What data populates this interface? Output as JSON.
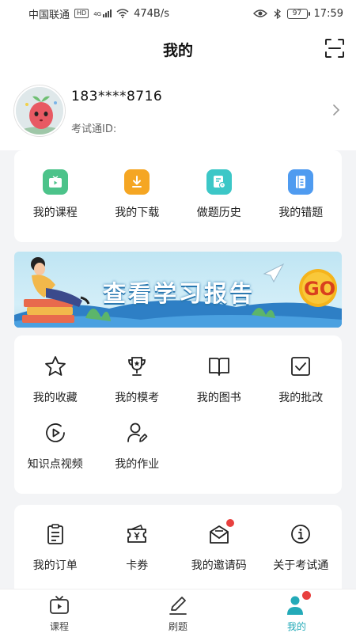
{
  "status_bar": {
    "carrier": "中国联通",
    "hd": "HD",
    "net": "4G",
    "speed": "474B/s",
    "battery": "97",
    "time": "17:59"
  },
  "header": {
    "title": "我的"
  },
  "profile": {
    "phone": "183****8716",
    "exam_id_label": "考试通ID:"
  },
  "quick_menu": [
    {
      "label": "我的课程",
      "icon": "video-icon",
      "color": "#4cc38a"
    },
    {
      "label": "我的下载",
      "icon": "download-icon",
      "color": "#f5a623"
    },
    {
      "label": "做题历史",
      "icon": "history-icon",
      "color": "#3cc7c7"
    },
    {
      "label": "我的错题",
      "icon": "notebook-icon",
      "color": "#4f9bf0"
    }
  ],
  "banner": {
    "text": "查看学习报告",
    "go": "GO"
  },
  "tools_menu": [
    {
      "label": "我的收藏",
      "icon": "star-icon"
    },
    {
      "label": "我的模考",
      "icon": "trophy-icon"
    },
    {
      "label": "我的图书",
      "icon": "book-icon"
    },
    {
      "label": "我的批改",
      "icon": "checkbox-icon"
    },
    {
      "label": "知识点视频",
      "icon": "play-icon"
    },
    {
      "label": "我的作业",
      "icon": "user-edit-icon"
    }
  ],
  "service_menu": [
    {
      "label": "我的订单",
      "icon": "order-icon"
    },
    {
      "label": "卡券",
      "icon": "coupon-icon"
    },
    {
      "label": "我的邀请码",
      "icon": "mail-icon"
    },
    {
      "label": "关于考试通",
      "icon": "info-icon"
    }
  ],
  "tabbar": [
    {
      "label": "课程",
      "icon": "tv-icon"
    },
    {
      "label": "刷题",
      "icon": "pen-icon"
    },
    {
      "label": "我的",
      "icon": "person-icon",
      "active": true
    }
  ],
  "colors": {
    "accent": "#23aab8",
    "badge": "#e8403e"
  }
}
